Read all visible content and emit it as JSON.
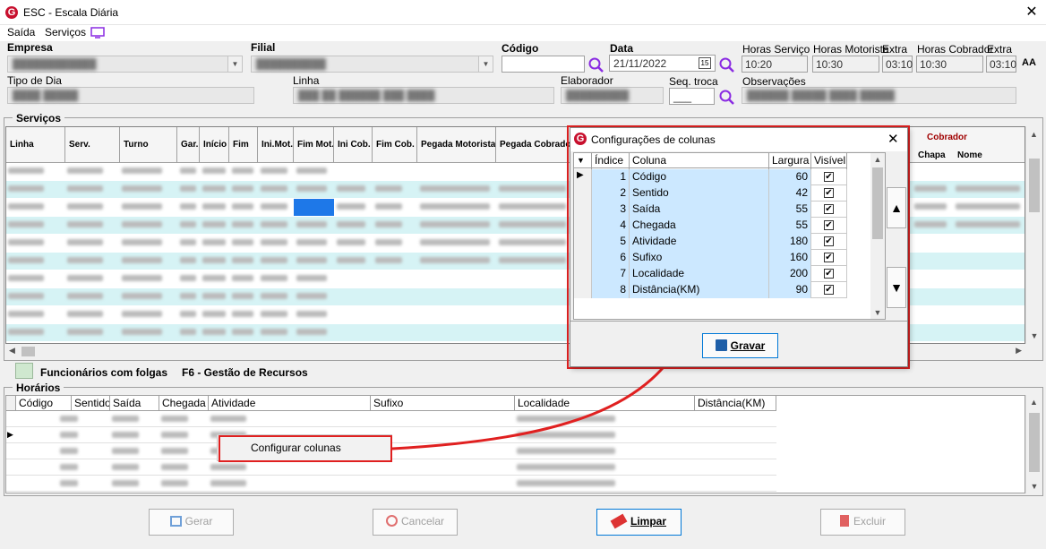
{
  "window": {
    "title": "ESC - Escala Diária",
    "close": "✕",
    "logo": "G"
  },
  "menu": {
    "saida": "Saída",
    "servicos": "Serviços"
  },
  "filters": {
    "empresa_label": "Empresa",
    "filial_label": "Filial",
    "codigo_label": "Código",
    "data_label": "Data",
    "data_value": "21/11/2022",
    "horas_servico_label": "Horas Serviço",
    "horas_servico_value": "10:20",
    "horas_motorista_label": "Horas Motorista",
    "horas_motorista_value": "10:30",
    "extra_label": "Extra",
    "extra_mot_value": "03:10",
    "horas_cobrador_label": "Horas Cobrador",
    "horas_cobrador_value": "10:30",
    "extra_cob_value": "03:10",
    "font_icon": "AA",
    "tipo_dia_label": "Tipo de Dia",
    "linha_label": "Linha",
    "elaborador_label": "Elaborador",
    "seq_troca_label": "Seq. troca",
    "seq_troca_value": "___",
    "observacoes_label": "Observações"
  },
  "servicos": {
    "title": "Serviços",
    "columns": [
      "Linha",
      "Serv.",
      "Turno",
      "Gar.",
      "Início",
      "Fim",
      "Ini.Mot.",
      "Fim Mot.",
      "Ini Cob.",
      "Fim Cob.",
      "Pegada Motorista",
      "Pegada Cobrado"
    ],
    "cobrador_group": "Cobrador",
    "cobrador_columns": [
      "Chapa",
      "Nome"
    ]
  },
  "legend": {
    "folgas": "Funcionários com folgas",
    "f6": "F6 - Gestão de Recursos"
  },
  "horarios": {
    "title": "Horários",
    "columns": [
      "Código",
      "Sentido",
      "Saída",
      "Chegada",
      "Atividade",
      "Sufixo",
      "Localidade",
      "Distância(KM)"
    ]
  },
  "context_menu": {
    "configurar": "Configurar colunas"
  },
  "dialog": {
    "title": "Configurações de colunas",
    "close": "✕",
    "columns": [
      "Índice",
      "Coluna",
      "Largura",
      "Visível"
    ],
    "rows": [
      {
        "indice": "1",
        "coluna": "Código",
        "largura": "60",
        "visivel": true
      },
      {
        "indice": "2",
        "coluna": "Sentido",
        "largura": "42",
        "visivel": true
      },
      {
        "indice": "3",
        "coluna": "Saída",
        "largura": "55",
        "visivel": true
      },
      {
        "indice": "4",
        "coluna": "Chegada",
        "largura": "55",
        "visivel": true
      },
      {
        "indice": "5",
        "coluna": "Atividade",
        "largura": "180",
        "visivel": true
      },
      {
        "indice": "6",
        "coluna": "Sufixo",
        "largura": "160",
        "visivel": true
      },
      {
        "indice": "7",
        "coluna": "Localidade",
        "largura": "200",
        "visivel": true
      },
      {
        "indice": "8",
        "coluna": "Distância(KM)",
        "largura": "90",
        "visivel": true
      }
    ],
    "gravar": "Gravar"
  },
  "buttons": {
    "gerar": "Gerar",
    "cancelar": "Cancelar",
    "limpar": "Limpar",
    "excluir": "Excluir"
  },
  "colors": {
    "accent": "#e02020",
    "row_alt": "#d6f3f5",
    "selected": "#cce8ff",
    "brand": "#c8102e"
  }
}
